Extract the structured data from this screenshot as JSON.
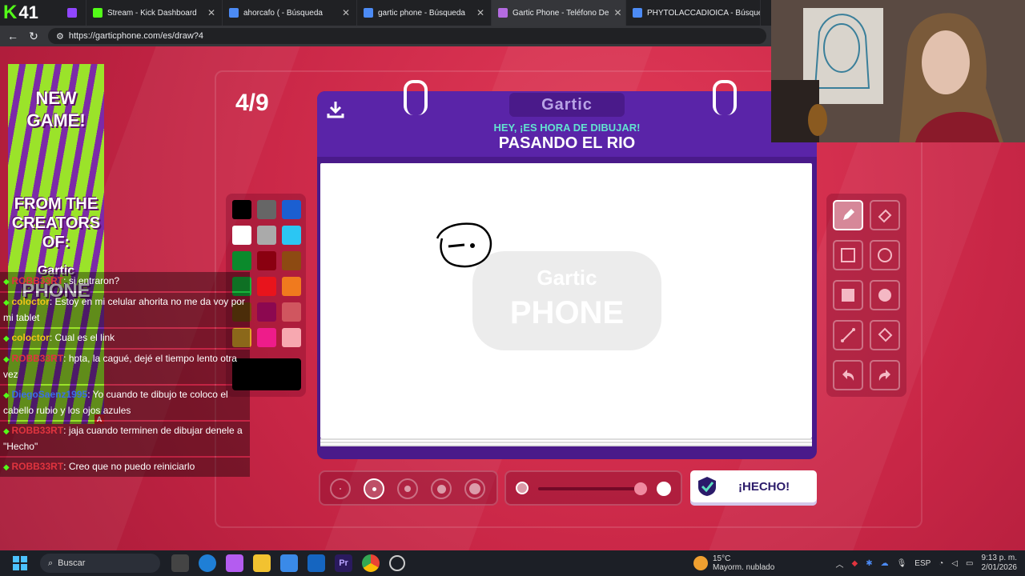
{
  "browser": {
    "counter": "41",
    "tabs": [
      {
        "title": "Stream - Kick Dashboard",
        "color": "#53fc18"
      },
      {
        "title": "ahorcafo ( - Búsqueda",
        "color": "#4c8bf5"
      },
      {
        "title": "gartic phone - Búsqueda",
        "color": "#4c8bf5"
      },
      {
        "title": "Gartic Phone - Teléfono De",
        "color": "#b46be0"
      },
      {
        "title": "PHYTOLACCADIOICA - Búsqued",
        "color": "#4c8bf5"
      }
    ],
    "url": "https://garticphone.com/es/draw?4"
  },
  "game": {
    "round": "4/9",
    "logo": "Gartic",
    "subtitle": "HEY, ¡ES HORA DE DIBUJAR!",
    "theme": "PASANDO EL RIO",
    "done_label": "¡HECHO!",
    "watermark_top": "Gartic",
    "watermark_bottom": "PHONE",
    "colors": [
      "#000000",
      "#666666",
      "#1b5fd1",
      "#ffffff",
      "#aaaaaa",
      "#2bc6f3",
      "#0b8a2c",
      "#8a0010",
      "#8d4a12",
      "#19b53a",
      "#e8141c",
      "#f07a1e",
      "#7a4a10",
      "#8c0850",
      "#d0565f",
      "#e0a82a",
      "#ee1c8a",
      "#f7a8b0"
    ],
    "current_color": "#000000",
    "brush_sizes": 5,
    "selected_size": 2
  },
  "ad": {
    "line1": "NEW",
    "line2": "GAME!",
    "line3": "FROM THE",
    "line4": "CREATORS",
    "line5": "OF:",
    "line6": "Gartic",
    "line7": "PHONE",
    "badge": "A"
  },
  "chat": [
    {
      "user": "ROBB33RT",
      "color": "#e0343e",
      "text": ": si entraron?"
    },
    {
      "user": "coloctor",
      "color": "#f0c419",
      "text": ": Estoy en mi celular ahorita no me da voy por mi tablet"
    },
    {
      "user": "coloctor",
      "color": "#f0c419",
      "text": ": Cual es el link"
    },
    {
      "user": "ROBB33RT",
      "color": "#e0343e",
      "text": ": hpta, la cagué, dejé el tiempo lento otra vez"
    },
    {
      "user": "DiegoSaenz1995",
      "color": "#3a6ee8",
      "text": ": Yo cuando te dibujo te coloco el cabello rubio y los ojos azules"
    },
    {
      "user": "ROBB33RT",
      "color": "#e0343e",
      "text": ": jaja cuando terminen de dibujar denele a \"Hecho\""
    },
    {
      "user": "ROBB33RT",
      "color": "#e0343e",
      "text": ": Creo que no puedo reiniciarlo"
    }
  ],
  "taskbar": {
    "search": "Buscar",
    "temp": "15°C",
    "weather": "Mayorm. nublado",
    "lang": "ESP",
    "time": "9:13 p. m.",
    "date": "2/01/2026"
  }
}
